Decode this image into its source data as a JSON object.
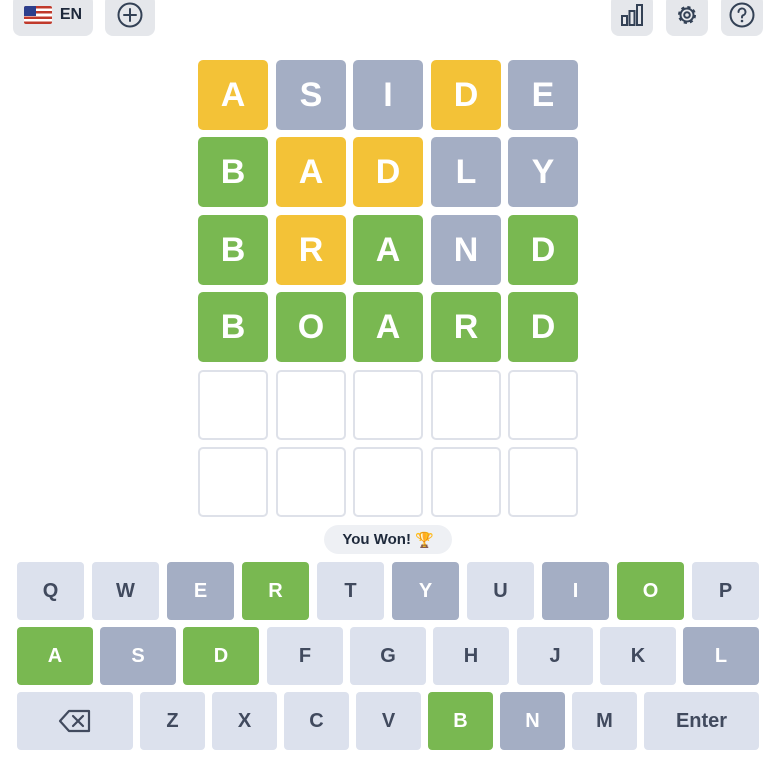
{
  "header": {
    "language_code": "EN",
    "icons": [
      "us-flag-icon",
      "plus-circle-icon",
      "bar-chart-icon",
      "gear-icon",
      "question-circle-icon"
    ]
  },
  "colors": {
    "correct": "#79b851",
    "present": "#f3c237",
    "absent": "#a4aec4",
    "key_default": "#dce1ed",
    "empty_border": "#dee1e9"
  },
  "board": {
    "rows": [
      [
        {
          "letter": "A",
          "state": "present"
        },
        {
          "letter": "S",
          "state": "absent"
        },
        {
          "letter": "I",
          "state": "absent"
        },
        {
          "letter": "D",
          "state": "present"
        },
        {
          "letter": "E",
          "state": "absent"
        }
      ],
      [
        {
          "letter": "B",
          "state": "correct"
        },
        {
          "letter": "A",
          "state": "present"
        },
        {
          "letter": "D",
          "state": "present"
        },
        {
          "letter": "L",
          "state": "absent"
        },
        {
          "letter": "Y",
          "state": "absent"
        }
      ],
      [
        {
          "letter": "B",
          "state": "correct"
        },
        {
          "letter": "R",
          "state": "present"
        },
        {
          "letter": "A",
          "state": "correct"
        },
        {
          "letter": "N",
          "state": "absent"
        },
        {
          "letter": "D",
          "state": "correct"
        }
      ],
      [
        {
          "letter": "B",
          "state": "correct"
        },
        {
          "letter": "O",
          "state": "correct"
        },
        {
          "letter": "A",
          "state": "correct"
        },
        {
          "letter": "R",
          "state": "correct"
        },
        {
          "letter": "D",
          "state": "correct"
        }
      ],
      [
        {
          "letter": "",
          "state": "empty"
        },
        {
          "letter": "",
          "state": "empty"
        },
        {
          "letter": "",
          "state": "empty"
        },
        {
          "letter": "",
          "state": "empty"
        },
        {
          "letter": "",
          "state": "empty"
        }
      ],
      [
        {
          "letter": "",
          "state": "empty"
        },
        {
          "letter": "",
          "state": "empty"
        },
        {
          "letter": "",
          "state": "empty"
        },
        {
          "letter": "",
          "state": "empty"
        },
        {
          "letter": "",
          "state": "empty"
        }
      ]
    ]
  },
  "status": {
    "message": "You Won!",
    "emoji": "🏆"
  },
  "keyboard": {
    "rows": [
      [
        {
          "label": "Q",
          "state": "default"
        },
        {
          "label": "W",
          "state": "default"
        },
        {
          "label": "E",
          "state": "absent"
        },
        {
          "label": "R",
          "state": "correct"
        },
        {
          "label": "T",
          "state": "default"
        },
        {
          "label": "Y",
          "state": "absent"
        },
        {
          "label": "U",
          "state": "default"
        },
        {
          "label": "I",
          "state": "absent"
        },
        {
          "label": "O",
          "state": "correct"
        },
        {
          "label": "P",
          "state": "default"
        }
      ],
      [
        {
          "label": "A",
          "state": "correct"
        },
        {
          "label": "S",
          "state": "absent"
        },
        {
          "label": "D",
          "state": "correct"
        },
        {
          "label": "F",
          "state": "default"
        },
        {
          "label": "G",
          "state": "default"
        },
        {
          "label": "H",
          "state": "default"
        },
        {
          "label": "J",
          "state": "default"
        },
        {
          "label": "K",
          "state": "default"
        },
        {
          "label": "L",
          "state": "absent"
        }
      ],
      [
        {
          "label": "",
          "state": "default",
          "icon": "backspace-icon"
        },
        {
          "label": "Z",
          "state": "default"
        },
        {
          "label": "X",
          "state": "default"
        },
        {
          "label": "C",
          "state": "default"
        },
        {
          "label": "V",
          "state": "default"
        },
        {
          "label": "B",
          "state": "correct"
        },
        {
          "label": "N",
          "state": "absent"
        },
        {
          "label": "M",
          "state": "default"
        },
        {
          "label": "Enter",
          "state": "default"
        }
      ]
    ]
  }
}
